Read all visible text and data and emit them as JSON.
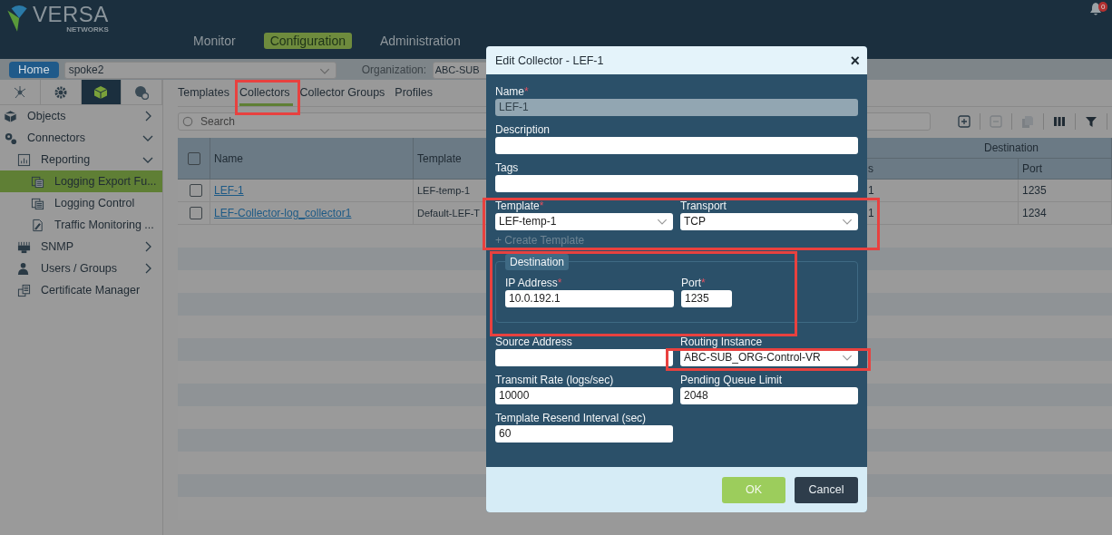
{
  "header": {
    "logo_text": "VERSA",
    "logo_subtext": "NETWORKS",
    "notification_count": "0",
    "nav": [
      {
        "label": "Monitor",
        "selected": false
      },
      {
        "label": "Configuration",
        "selected": true
      },
      {
        "label": "Administration",
        "selected": false
      }
    ]
  },
  "context_bar": {
    "home": "Home",
    "device": "spoke2",
    "organization_label": "Organization:",
    "organization": "ABC-SUB"
  },
  "sidebar": {
    "icon_tabs": [
      {
        "selected": false
      },
      {
        "selected": false
      },
      {
        "selected": true
      },
      {
        "selected": false
      }
    ],
    "items": [
      {
        "label": "Objects",
        "expanded": false,
        "selected": false
      },
      {
        "label": "Connectors",
        "expanded": true,
        "selected": false,
        "children": [
          {
            "label": "Reporting",
            "expanded": true,
            "selected": false,
            "children": [
              {
                "label": "Logging Export Fu...",
                "selected": true
              },
              {
                "label": "Logging Control",
                "selected": false
              },
              {
                "label": "Traffic Monitoring ...",
                "selected": false
              }
            ]
          },
          {
            "label": "SNMP",
            "expanded": false,
            "selected": false
          },
          {
            "label": "Users / Groups",
            "expanded": false,
            "selected": false
          },
          {
            "label": "Certificate Manager",
            "selected": false
          }
        ]
      }
    ]
  },
  "tabs": [
    {
      "label": "Templates",
      "selected": false
    },
    {
      "label": "Collectors",
      "selected": true
    },
    {
      "label": "Collector Groups",
      "selected": false
    },
    {
      "label": "Profiles",
      "selected": false
    }
  ],
  "search": {
    "placeholder": "Search"
  },
  "table": {
    "group_header": "Destination",
    "select_all_checked": false,
    "columns": [
      "Name",
      "Template",
      "s",
      "Port"
    ],
    "rows": [
      {
        "checked": false,
        "name": "LEF-1",
        "template": "LEF-temp-1",
        "column_4": "1",
        "port": "1235"
      },
      {
        "checked": false,
        "name": "LEF-Collector-log_collector1",
        "template": "Default-LEF-T",
        "column_4": "1",
        "port": "1234"
      }
    ]
  },
  "dialog": {
    "title": "Edit Collector - LEF-1",
    "close": "×",
    "full_fields": [
      {
        "label": "Name",
        "required_mark": "*",
        "disabled": true,
        "value": "LEF-1"
      },
      {
        "label": "Description",
        "disabled": false
      },
      {
        "label": "Tags",
        "disabled": false
      }
    ],
    "select_row": [
      {
        "label": "Template",
        "required_mark": "*",
        "kind": "select",
        "value": "LEF-temp-1"
      },
      {
        "label": "Transport",
        "kind": "select",
        "value": "TCP"
      }
    ],
    "create_link": "+ Create Template",
    "destination": {
      "legend": "Destination",
      "fields": [
        {
          "label": "IP Address",
          "required_mark": "*",
          "kind": "text",
          "value": "10.0.192.1"
        },
        {
          "label": "Port",
          "required_mark": "*",
          "kind": "short",
          "value": "1235"
        }
      ]
    },
    "fields": [
      {
        "label": "Source Address",
        "kind": "text"
      },
      {
        "label": "Routing Instance",
        "kind": "select",
        "value": "ABC-SUB_ORG-Control-VR"
      },
      {
        "label": "Transmit Rate (logs/sec)",
        "kind": "text",
        "value": "10000"
      },
      {
        "label": "Pending Queue Limit",
        "kind": "text",
        "value": "2048"
      },
      {
        "label": "Template Resend Interval (sec)",
        "kind": "text",
        "value": "60"
      }
    ],
    "buttons": [
      {
        "label": "OK",
        "kind": "primary"
      },
      {
        "label": "Cancel",
        "kind": "secondary"
      }
    ]
  }
}
